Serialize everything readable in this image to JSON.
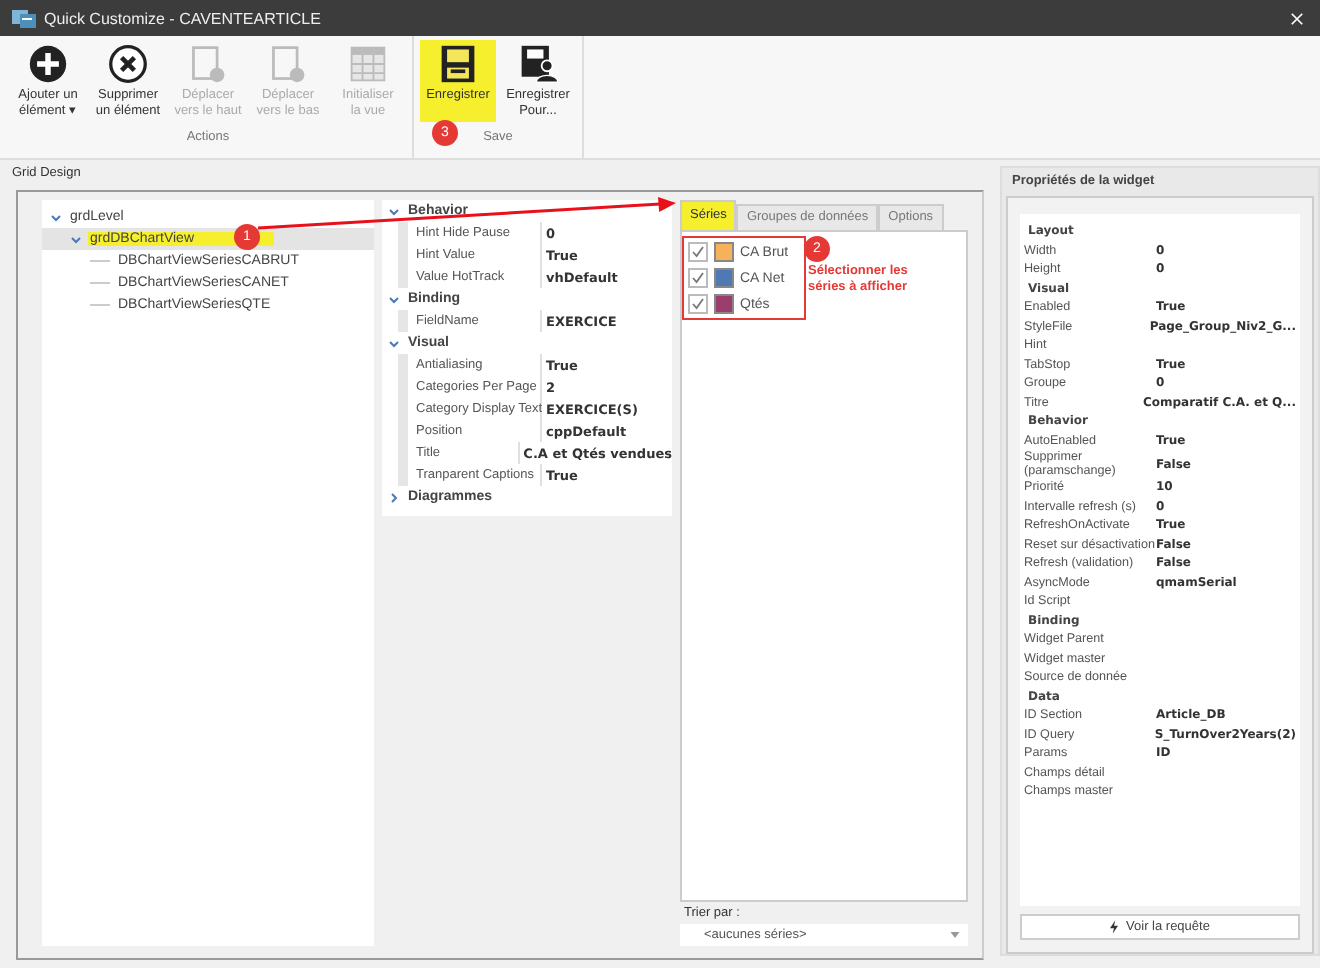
{
  "window": {
    "title": "Quick Customize - CAVENTEARTICLE"
  },
  "ribbon": {
    "groups": [
      {
        "label": "Actions",
        "buttons": [
          {
            "kind": "add",
            "lines": [
              "Ajouter un",
              "élément ▾"
            ],
            "disabled": false,
            "highlighted": false
          },
          {
            "kind": "delete",
            "lines": [
              "Supprimer",
              "un élément"
            ],
            "disabled": false,
            "highlighted": false
          },
          {
            "kind": "move-up",
            "lines": [
              "Déplacer",
              "vers le haut"
            ],
            "disabled": true,
            "highlighted": false
          },
          {
            "kind": "move-down",
            "lines": [
              "Déplacer",
              "vers le bas"
            ],
            "disabled": true,
            "highlighted": false
          },
          {
            "kind": "grid",
            "lines": [
              "Initialiser",
              "la vue"
            ],
            "disabled": true,
            "highlighted": false
          }
        ]
      },
      {
        "label": "Save",
        "buttons": [
          {
            "kind": "save",
            "lines": [
              "Enregistrer"
            ],
            "disabled": false,
            "highlighted": true,
            "badge": "3"
          },
          {
            "kind": "save-as",
            "lines": [
              "Enregistrer",
              "Pour..."
            ],
            "disabled": false,
            "highlighted": false
          }
        ]
      }
    ]
  },
  "section_label": "Grid Design",
  "tree": {
    "items": [
      {
        "label": "grdLevel",
        "expanded": true,
        "highlighted": false,
        "children": [
          {
            "label": "grdDBChartView",
            "expanded": true,
            "highlighted": true,
            "badge": "1",
            "children": [
              {
                "label": "DBChartViewSeriesCABRUT",
                "highlighted": false
              },
              {
                "label": "DBChartViewSeriesCANET",
                "highlighted": false
              },
              {
                "label": "DBChartViewSeriesQTE",
                "highlighted": false
              }
            ]
          }
        ]
      }
    ]
  },
  "properties": {
    "categories": [
      {
        "name": "Behavior",
        "expanded": true,
        "rows": [
          {
            "name": "Hint Hide Pause",
            "value": "0"
          },
          {
            "name": "Hint Value",
            "value": "True"
          },
          {
            "name": "Value HotTrack",
            "value": "vhDefault"
          }
        ]
      },
      {
        "name": "Binding",
        "expanded": true,
        "rows": [
          {
            "name": "FieldName",
            "value": "EXERCICE"
          }
        ]
      },
      {
        "name": "Visual",
        "expanded": true,
        "rows": [
          {
            "name": "Antialiasing",
            "value": "True"
          },
          {
            "name": "Categories Per Page",
            "value": "2"
          },
          {
            "name": "Category Display Text",
            "value": "EXERCICE(S)"
          },
          {
            "name": "Position",
            "value": "cppDefault"
          },
          {
            "name": "Title",
            "value": "C.A et Qtés vendues"
          },
          {
            "name": "Tranparent Captions",
            "value": "True"
          }
        ]
      },
      {
        "name": "Diagrammes",
        "expanded": false
      }
    ]
  },
  "series_panel": {
    "tabs": [
      {
        "label": "Séries",
        "selected": true,
        "highlighted": true
      },
      {
        "label": "Groupes de données",
        "selected": false,
        "highlighted": false
      },
      {
        "label": "Options",
        "selected": false,
        "highlighted": false
      }
    ],
    "series": [
      {
        "label": "CA Brut",
        "checked": true,
        "color": "#f4b35a"
      },
      {
        "label": "CA Net",
        "checked": true,
        "color": "#4f79b5"
      },
      {
        "label": "Qtés",
        "checked": true,
        "color": "#9b3e6b"
      }
    ],
    "badge": "2",
    "note": "Sélectionner les séries à afficher",
    "sort_label": "Trier par :",
    "sort_value": "<aucunes séries>"
  },
  "widget_panel": {
    "title": "Propriétés de la widget",
    "sections": [
      {
        "title": "Layout",
        "rows": [
          {
            "name": "Width",
            "value": "0"
          },
          {
            "name": "Height",
            "value": "0"
          }
        ]
      },
      {
        "title": "Visual",
        "rows": [
          {
            "name": "Enabled",
            "value": "True"
          },
          {
            "name": "StyleFile",
            "value": "Page_Group_Niv2_G..."
          },
          {
            "name": "Hint"
          },
          {
            "name": "TabStop",
            "value": "True"
          },
          {
            "name": "Groupe",
            "value": "0"
          },
          {
            "name": "Titre",
            "value": "Comparatif C.A. et Q..."
          }
        ]
      },
      {
        "title": "Behavior",
        "rows": [
          {
            "name": "AutoEnabled",
            "value": "True"
          },
          {
            "name": "Supprimer (paramschange)",
            "value": "False"
          },
          {
            "name": "Priorité",
            "value": "10"
          },
          {
            "name": "Intervalle refresh (s)",
            "value": "0"
          },
          {
            "name": "RefreshOnActivate",
            "value": "True"
          },
          {
            "name": "Reset sur désactivation",
            "value": "False"
          },
          {
            "name": "Refresh (validation)",
            "value": "False"
          },
          {
            "name": "AsyncMode",
            "value": "qmamSerial"
          },
          {
            "name": "Id Script"
          }
        ]
      },
      {
        "title": "Binding",
        "rows": [
          {
            "name": "Widget Parent"
          },
          {
            "name": "Widget master"
          },
          {
            "name": "Source de donnée"
          }
        ]
      },
      {
        "title": "Data",
        "rows": [
          {
            "name": "ID Section",
            "value": "Article_DB"
          },
          {
            "name": "ID Query",
            "value": "S_TurnOver2Years(2)"
          },
          {
            "name": "Params",
            "value": "ID"
          },
          {
            "name": "Champs détail"
          },
          {
            "name": "Champs master"
          }
        ]
      }
    ],
    "button": "Voir la requête"
  }
}
